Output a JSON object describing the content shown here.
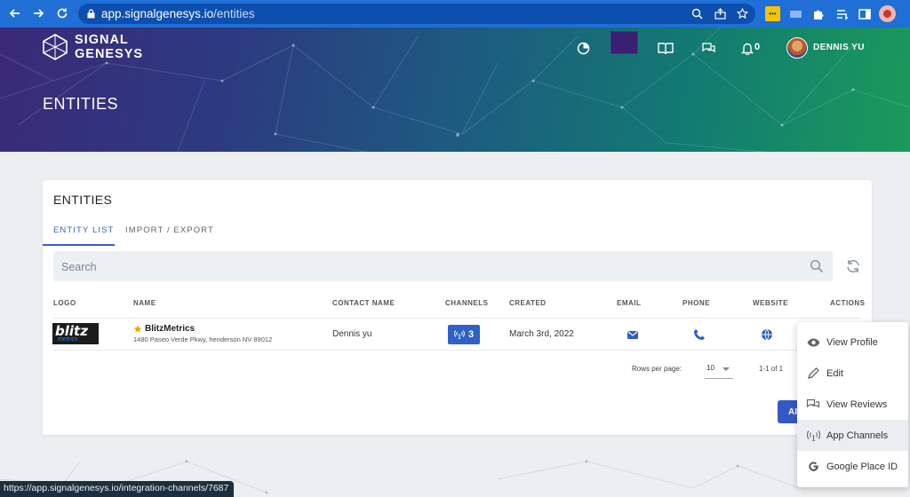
{
  "browser": {
    "url_host": "app.signalgenesys.io",
    "url_path": "/entities",
    "status_url": "https://app.signalgenesys.io/integration-channels/7687"
  },
  "header": {
    "logo_line1": "SIGNAL",
    "logo_line2": "GENESYS",
    "notification_count": "0",
    "user_name": "DENNIS YU",
    "page_title": "ENTITIES"
  },
  "card": {
    "title": "ENTITIES",
    "tabs": [
      {
        "label": "ENTITY LIST",
        "active": true
      },
      {
        "label": "IMPORT / EXPORT",
        "active": false
      }
    ],
    "search_placeholder": "Search"
  },
  "table": {
    "headers": [
      "LOGO",
      "NAME",
      "CONTACT NAME",
      "CHANNELS",
      "CREATED",
      "EMAIL",
      "PHONE",
      "WEBSITE",
      "ACTIONS"
    ],
    "rows": [
      {
        "logo_text": "blitz",
        "logo_subtext": "metrics",
        "name": "BlitzMetrics",
        "address": "1480 Paseo Verde Pkwy, henderson NV 89012",
        "contact": "Dennis yu",
        "channels": "3",
        "created": "March 3rd, 2022"
      }
    ],
    "rows_per_page_label": "Rows per page:",
    "rows_per_page_value": "10",
    "page_range": "1-1 of 1",
    "add_button_partial": "AI"
  },
  "menu": {
    "items": [
      {
        "label": "View Profile",
        "icon": "eye-icon"
      },
      {
        "label": "Edit",
        "icon": "pencil-icon"
      },
      {
        "label": "View Reviews",
        "icon": "chat-icon"
      },
      {
        "label": "App Channels",
        "icon": "broadcast-icon",
        "hover": true
      },
      {
        "label": "Google Place ID",
        "icon": "google-icon"
      }
    ]
  },
  "colors": {
    "browser_bar": "#1f6fd6",
    "primary": "#3060c8",
    "menu_hover": "#ebedf0"
  }
}
